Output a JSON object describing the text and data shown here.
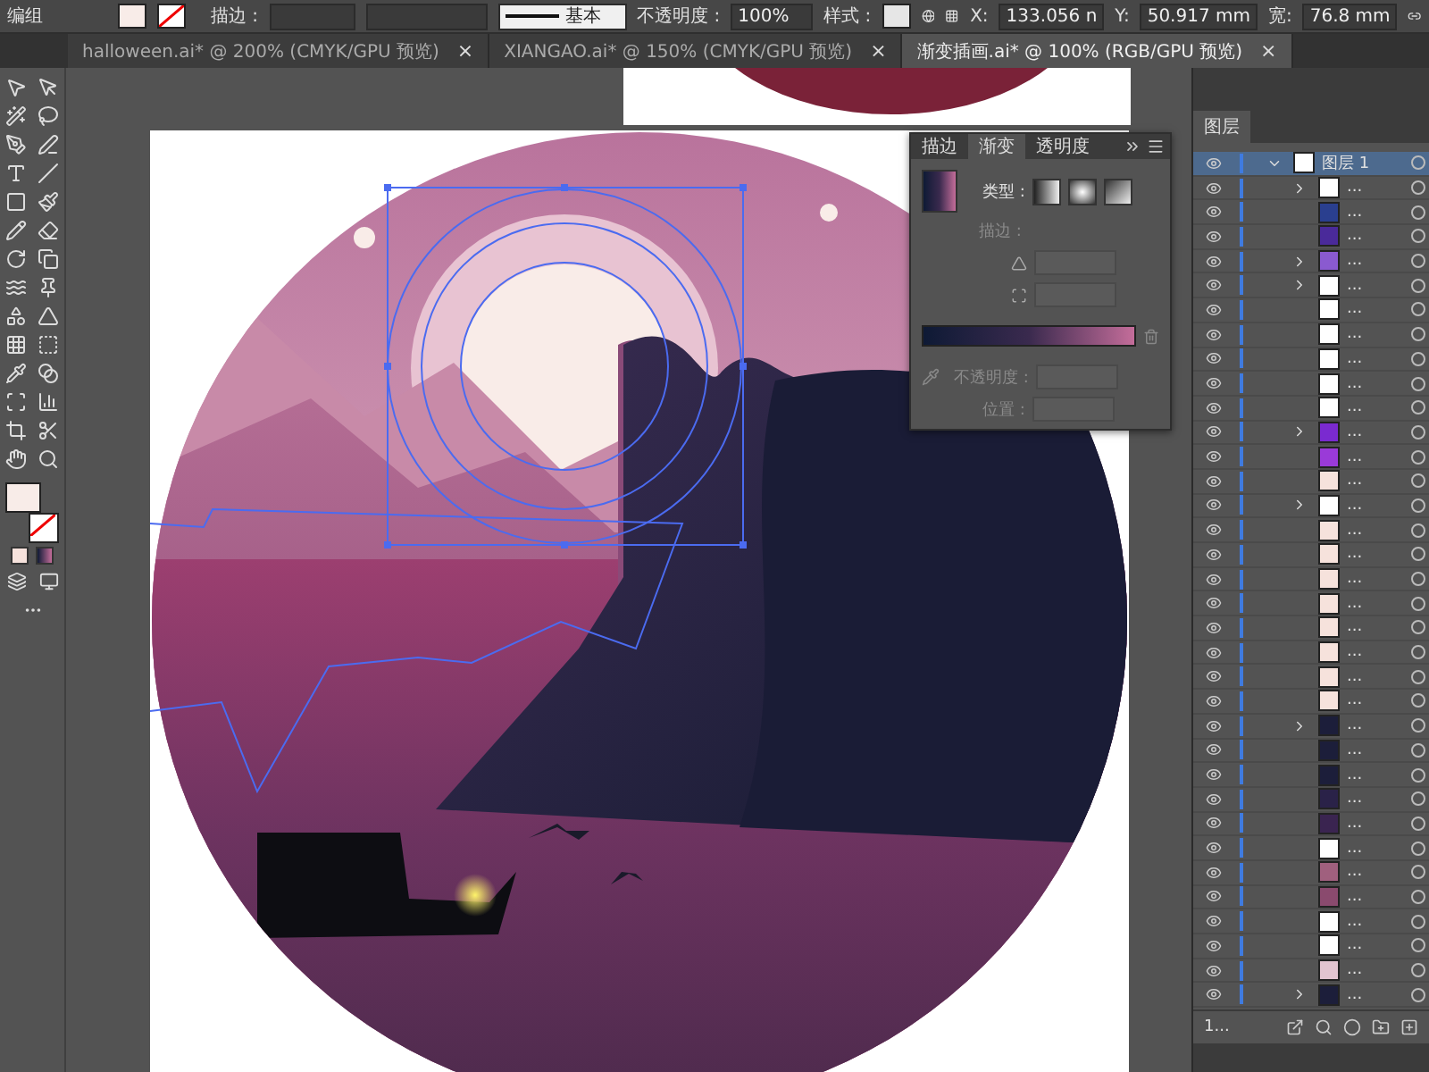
{
  "control_bar": {
    "selection": "编组",
    "stroke_label": "描边 :",
    "stroke_style": "基本",
    "opacity_label": "不透明度 :",
    "opacity": "100%",
    "style_label": "样式 :",
    "x_label": "X:",
    "x": "133.056 n",
    "y_label": "Y:",
    "y": "50.917 mm",
    "w_label": "宽:",
    "w": "76.8 mm"
  },
  "tabs": [
    {
      "label": "halloween.ai* @ 200% (CMYK/GPU 预览)",
      "close": "×",
      "selected": false
    },
    {
      "label": "XIANGAO.ai* @ 150% (CMYK/GPU 预览)",
      "close": "×",
      "selected": false
    },
    {
      "label": "渐变插画.ai* @ 100% (RGB/GPU 预览)",
      "close": "×",
      "selected": true
    }
  ],
  "gradient_panel": {
    "tabs": [
      {
        "label": "描边",
        "selected": false
      },
      {
        "label": "渐变",
        "selected": true
      },
      {
        "label": "透明度",
        "selected": false
      }
    ],
    "type_label": "类型 :",
    "stroke_label": "描边 :",
    "opacity_label": "不透明度 :",
    "position_label": "位置 :",
    "disabled": true
  },
  "layers_panel": {
    "title": "图层",
    "footer": "1...",
    "rows": [
      {
        "label": "图层 1",
        "kind": "layer",
        "expanded": true,
        "selected": true,
        "color": "#ffffff"
      },
      {
        "label": "...",
        "kind": "item",
        "expanded": false,
        "selected": false,
        "color": "#ffffff"
      },
      {
        "label": "...",
        "kind": "item",
        "selected": false,
        "color": "#2a3f8f"
      },
      {
        "label": "...",
        "kind": "item",
        "selected": false,
        "color": "#4a2a9a"
      },
      {
        "label": "...",
        "kind": "item",
        "expanded": false,
        "selected": false,
        "color": "#8a5ad0"
      },
      {
        "label": "...",
        "kind": "item",
        "expanded": false,
        "selected": false,
        "color": "#ffffff"
      },
      {
        "label": "...",
        "kind": "item",
        "selected": false,
        "color": "#ffffff"
      },
      {
        "label": "...",
        "kind": "item",
        "selected": false,
        "color": "#ffffff"
      },
      {
        "label": "...",
        "kind": "item",
        "selected": false,
        "color": "#ffffff"
      },
      {
        "label": "...",
        "kind": "item",
        "selected": false,
        "color": "#ffffff"
      },
      {
        "label": "...",
        "kind": "item",
        "selected": false,
        "color": "#ffffff"
      },
      {
        "label": "...",
        "kind": "item",
        "expanded": false,
        "selected": false,
        "color": "#7a2ad0"
      },
      {
        "label": "...",
        "kind": "item",
        "selected": false,
        "color": "#9a3ad8"
      },
      {
        "label": "...",
        "kind": "item",
        "selected": false,
        "color": "#f6e2dc"
      },
      {
        "label": "...",
        "kind": "item",
        "expanded": false,
        "selected": false,
        "color": "#ffffff"
      },
      {
        "label": "...",
        "kind": "item",
        "selected": false,
        "color": "#f6e2dc"
      },
      {
        "label": "...",
        "kind": "item",
        "selected": false,
        "color": "#f6e2dc"
      },
      {
        "label": "...",
        "kind": "item",
        "selected": false,
        "color": "#f6e2dc"
      },
      {
        "label": "...",
        "kind": "item",
        "selected": false,
        "color": "#f6e2dc"
      },
      {
        "label": "...",
        "kind": "item",
        "selected": false,
        "color": "#f6e2dc"
      },
      {
        "label": "...",
        "kind": "item",
        "selected": false,
        "color": "#f6e2dc"
      },
      {
        "label": "...",
        "kind": "item",
        "selected": false,
        "color": "#f6e2dc"
      },
      {
        "label": "...",
        "kind": "item",
        "selected": false,
        "color": "#f6e2dc"
      },
      {
        "label": "...",
        "kind": "item",
        "expanded": false,
        "selected": false,
        "color": "#1c1e3a"
      },
      {
        "label": "...",
        "kind": "item",
        "selected": false,
        "color": "#1c1e3a"
      },
      {
        "label": "...",
        "kind": "item",
        "selected": false,
        "color": "#1c1e3a"
      },
      {
        "label": "...",
        "kind": "item",
        "selected": false,
        "color": "#2a2248"
      },
      {
        "label": "...",
        "kind": "item",
        "selected": false,
        "color": "#3a2450"
      },
      {
        "label": "...",
        "kind": "item",
        "selected": false,
        "color": "#ffffff"
      },
      {
        "label": "...",
        "kind": "item",
        "selected": false,
        "color": "#a0607e"
      },
      {
        "label": "...",
        "kind": "item",
        "selected": false,
        "color": "#8a4a6e"
      },
      {
        "label": "...",
        "kind": "item",
        "selected": false,
        "color": "#ffffff"
      },
      {
        "label": "...",
        "kind": "item",
        "selected": false,
        "color": "#ffffff"
      },
      {
        "label": "...",
        "kind": "item",
        "selected": false,
        "color": "#e2c4d0"
      },
      {
        "label": "...",
        "kind": "item",
        "expanded": false,
        "selected": false,
        "color": "#1c1e3a"
      }
    ]
  }
}
